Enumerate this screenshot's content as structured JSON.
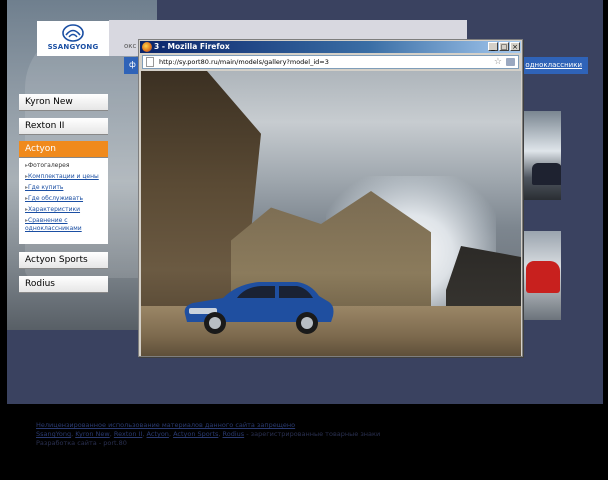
{
  "site": {
    "logo_text": "SSANGYONG",
    "header_text": "окс",
    "nav": {
      "left_label": "ф",
      "right_link": "одноклассники"
    },
    "side_menu": [
      {
        "label": "Kyron New",
        "active": false
      },
      {
        "label": "Rexton II",
        "active": false
      },
      {
        "label": "Actyon",
        "active": true
      },
      {
        "label": "Actyon Sports",
        "active": false
      },
      {
        "label": "Rodius",
        "active": false
      }
    ],
    "submenu": [
      "Фотогалерея",
      "Комплектации и цены",
      "Где купить",
      "Где обслуживать",
      "Характеристики",
      "Сравнение с одноклассниками"
    ],
    "footer": {
      "line1": "Нелицензированное использование материалов данного сайта запрещено",
      "links": [
        "SsangYong",
        "Kyron New",
        "Rexton II",
        "Actyon",
        "Actyon Sports",
        "Rodius"
      ],
      "line2_suffix": " - зарегистрированные товарные знаки",
      "line3": "Разработка сайта - port.80"
    }
  },
  "popup": {
    "title": "3 - Mozilla Firefox",
    "url": "http://sy.port80.ru/main/models/gallery?model_id=3",
    "controls": {
      "minimize": "_",
      "maximize": "□",
      "close": "×"
    }
  },
  "colors": {
    "site_background": "#3a4260",
    "nav_blue": "#2f63b8",
    "active_orange": "#f08a1c",
    "car_blue": "#1f4fa0"
  },
  "icons": {
    "bookmark": "star-icon",
    "page": "page-icon"
  }
}
